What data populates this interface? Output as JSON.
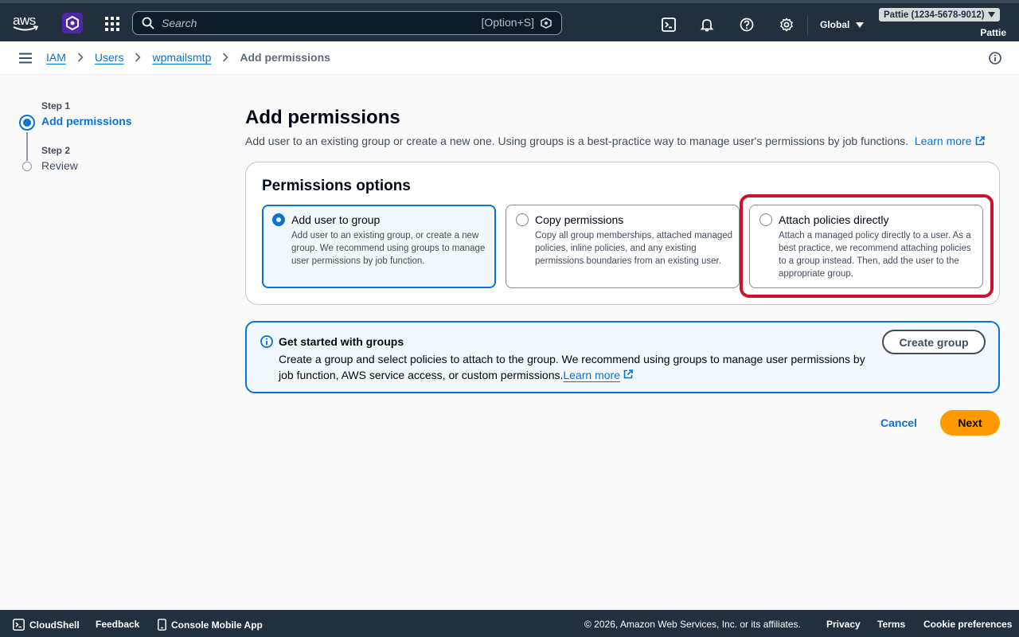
{
  "topnav": {
    "logo_text": "aws",
    "search_placeholder": "Search",
    "search_shortcut": "[Option+S]",
    "region": "Global",
    "account": "Pattie (1234-5678-9012)",
    "username": "Pattie"
  },
  "breadcrumb": {
    "items": [
      "IAM",
      "Users",
      "wpmailsmtp"
    ],
    "current": "Add permissions"
  },
  "steps": [
    {
      "label": "Step 1",
      "title": "Add permissions"
    },
    {
      "label": "Step 2",
      "title": "Review"
    }
  ],
  "main": {
    "title": "Add permissions",
    "description": "Add user to an existing group or create a new one. Using groups is a best-practice way to manage user's permissions by job functions.",
    "learn_more": "Learn more"
  },
  "permissions": {
    "heading": "Permissions options",
    "options": [
      {
        "title": "Add user to group",
        "desc": "Add user to an existing group, or create a new group. We recommend using groups to manage user permissions by job function.",
        "selected": true
      },
      {
        "title": "Copy permissions",
        "desc": "Copy all group memberships, attached managed policies, inline policies, and any existing permissions boundaries from an existing user.",
        "selected": false
      },
      {
        "title": "Attach policies directly",
        "desc": "Attach a managed policy directly to a user. As a best practice, we recommend attaching policies to a group instead. Then, add the user to the appropriate group.",
        "selected": false
      }
    ]
  },
  "alert": {
    "title": "Get started with groups",
    "body": "Create a group and select policies to attach to the group. We recommend using groups to manage user permissions by job function, AWS service access, or custom permissions.",
    "link": "Learn more",
    "button": "Create group"
  },
  "actions": {
    "cancel": "Cancel",
    "next": "Next"
  },
  "footer": {
    "cloudshell": "CloudShell",
    "feedback": "Feedback",
    "mobile_app": "Console Mobile App",
    "copyright": "© 2026, Amazon Web Services, Inc. or its affiliates.",
    "privacy": "Privacy",
    "terms": "Terms",
    "cookies": "Cookie preferences"
  },
  "colors": {
    "nav_bg": "#232f3e",
    "link_blue": "#0972d3",
    "primary_button": "#ff9900",
    "highlight_red": "#d0112b"
  }
}
